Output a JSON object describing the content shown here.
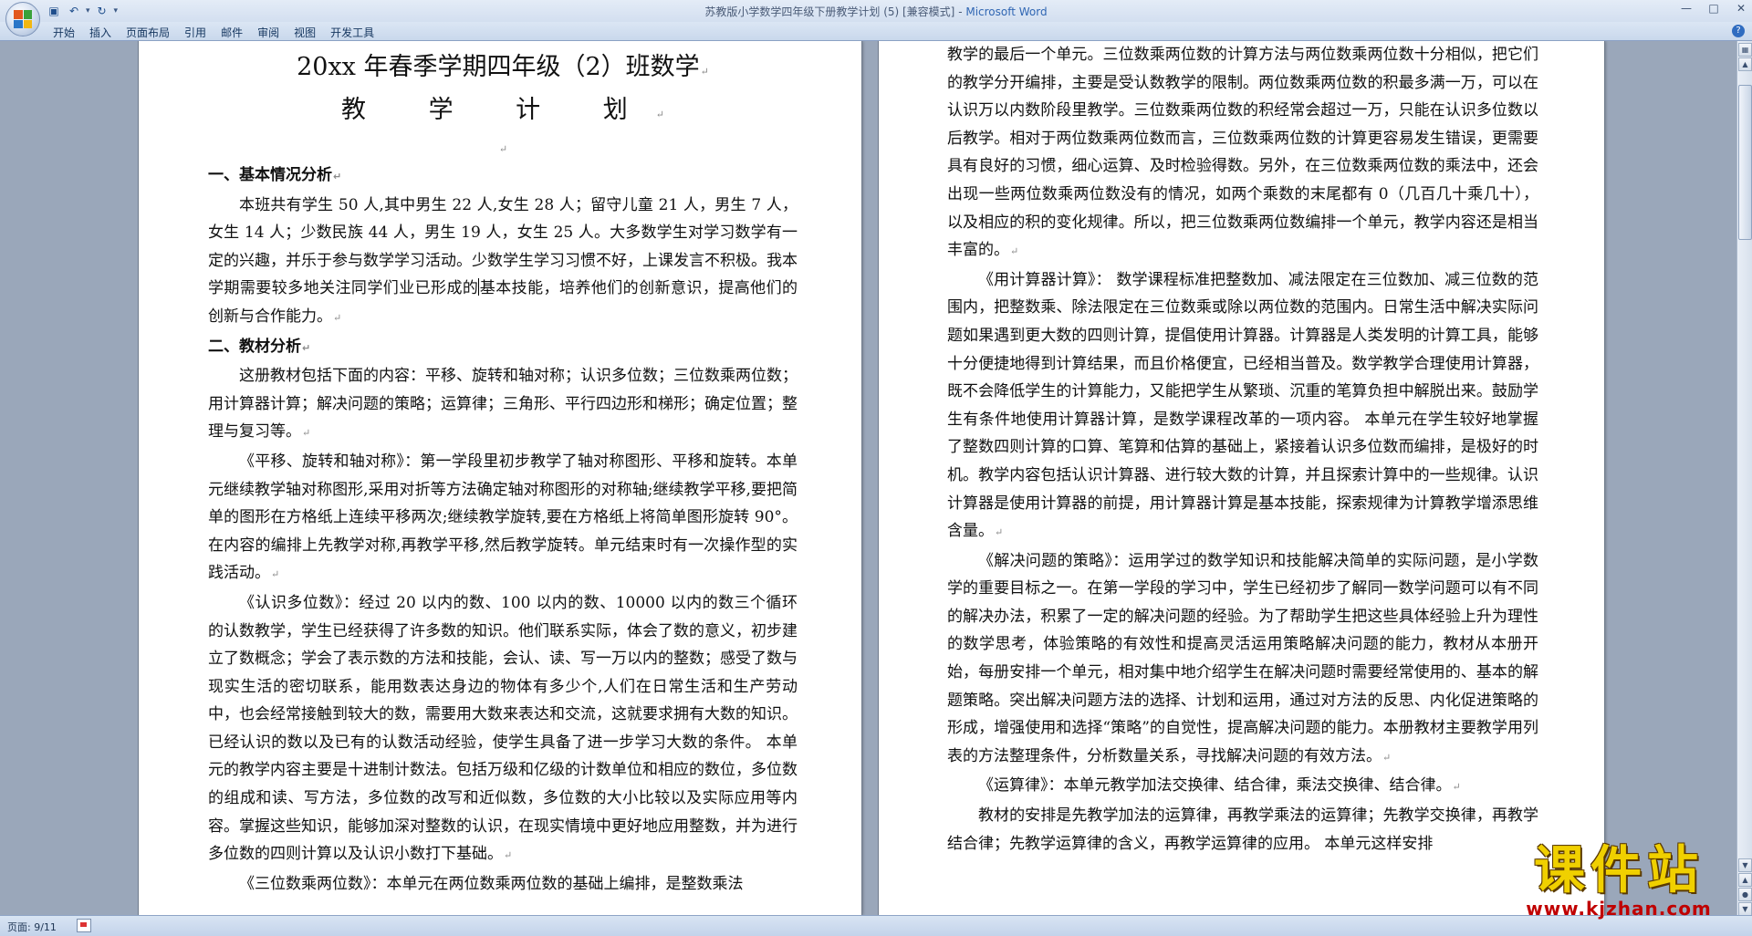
{
  "window": {
    "title": "苏教版小学数学四年级下册教学计划 (5) [兼容模式]",
    "app_name": "Microsoft Word",
    "title_separator": " - "
  },
  "quick_access": {
    "icons": [
      "save-icon",
      "undo-icon",
      "redo-icon",
      "customize-icon"
    ]
  },
  "ribbon": {
    "tabs": [
      "开始",
      "插入",
      "页面布局",
      "引用",
      "邮件",
      "审阅",
      "视图",
      "开发工具"
    ],
    "help_label": "?"
  },
  "status": {
    "page": "页面: 9/11"
  },
  "colors": {
    "app_background": "#9aa7ba",
    "title_blue": "#3066b3",
    "watermark_yellow": "#f0d000",
    "watermark_red": "#c00000"
  },
  "left_page": {
    "title_line1": "20xx 年春季学期四年级（2）班数学",
    "title_line2": "教 学 计 划",
    "section1_heading": "一、基本情况分析",
    "p1_before_cursor": "本班共有学生 50 人,其中男生 22 人,女生 28 人；留守儿童 21 人，男生 7 人，女生 14 人；少数民族 44 人，男生 19 人，女生 25 人。大多数学生对学习数学有一定的兴趣，并乐于参与数学学习活动。少数学生学习习惯不好，上课发言不积极。我本学期需要较多地关注同学们业已形成的",
    "p1_after_cursor": "基本技能，培养他们的创新意识，提高他们的创新与合作能力。",
    "section2_heading": "二、教材分析",
    "p2": "这册教材包括下面的内容：平移、旋转和轴对称；认识多位数；三位数乘两位数；用计算器计算；解决问题的策略；运算律；三角形、平行四边形和梯形；确定位置；整理与复习等。",
    "p3": "《平移、旋转和轴对称》：第一学段里初步教学了轴对称图形、平移和旋转。本单元继续教学轴对称图形,采用对折等方法确定轴对称图形的对称轴;继续教学平移,要把简单的图形在方格纸上连续平移两次;继续教学旋转,要在方格纸上将简单图形旋转 90°。在内容的编排上先教学对称,再教学平移,然后教学旋转。单元结束时有一次操作型的实践活动。",
    "p4": "《认识多位数》：经过 20 以内的数、100 以内的数、10000 以内的数三个循环的认数教学，学生已经获得了许多数的知识。他们联系实际，体会了数的意义，初步建立了数概念；学会了表示数的方法和技能，会认、读、写一万以内的整数；感受了数与现实生活的密切联系，能用数表达身边的物体有多少个,人们在日常生活和生产劳动中，也会经常接触到较大的数，需要用大数来表达和交流，这就要求拥有大数的知识。已经认识的数以及已有的认数活动经验，使学生具备了进一步学习大数的条件。      本单元的教学内容主要是十进制计数法。包括万级和亿级的计数单位和相应的数位，多位数的组成和读、写方法，多位数的改写和近似数，多位数的大小比较以及实际应用等内容。掌握这些知识，能够加深对整数的认识，在现实情境中更好地应用整数，并为进行多位数的四则计算以及认识小数打下基础。",
    "p5": "《三位数乘两位数》：本单元在两位数乘两位数的基础上编排，是整数乘法"
  },
  "right_page": {
    "p1": "教学的最后一个单元。三位数乘两位数的计算方法与两位数乘两位数十分相似，把它们的教学分开编排，主要是受认数教学的限制。两位数乘两位数的积最多满一万，可以在认识万以内数阶段里教学。三位数乘两位数的积经常会超过一万，只能在认识多位数以后教学。相对于两位数乘两位数而言，三位数乘两位数的计算更容易发生错误，更需要具有良好的习惯，细心运算、及时检验得数。另外，在三位数乘两位数的乘法中，还会出现一些两位数乘两位数没有的情况，如两个乘数的末尾都有 0（几百几十乘几十），以及相应的积的变化规律。所以，把三位数乘两位数编排一个单元，教学内容还是相当丰富的。",
    "p2": "《用计算器计算》：     数学课程标准把整数加、减法限定在三位数加、减三位数的范围内，把整数乘、除法限定在三位数乘或除以两位数的范围内。日常生活中解决实际问题如果遇到更大数的四则计算，提倡使用计算器。计算器是人类发明的计算工具，能够十分便捷地得到计算结果，而且价格便宜，已经相当普及。数学教学合理使用计算器，既不会降低学生的计算能力，又能把学生从繁琐、沉重的笔算负担中解脱出来。鼓励学生有条件地使用计算器计算，是数学课程改革的一项内容。     本单元在学生较好地掌握了整数四则计算的口算、笔算和估算的基础上，紧接着认识多位数而编排，是极好的时机。教学内容包括认识计算器、进行较大数的计算，并且探索计算中的一些规律。认识计算器是使用计算器的前提，用计算器计算是基本技能，探索规律为计算教学增添思维含量。",
    "p3": "《解决问题的策略》：运用学过的数学知识和技能解决简单的实际问题，是小学数学的重要目标之一。在第一学段的学习中，学生已经初步了解同一数学问题可以有不同的解决办法，积累了一定的解决问题的经验。为了帮助学生把这些具体经验上升为理性的数学思考，体验策略的有效性和提高灵活运用策略解决问题的能力，教材从本册开始，每册安排一个单元，相对集中地介绍学生在解决问题时需要经常使用的、基本的解题策略。突出解决问题方法的选择、计划和运用，通过对方法的反思、内化促进策略的形成，增强使用和选择“策略”的自觉性，提高解决问题的能力。本册教材主要教学用列表的方法整理条件，分析数量关系，寻找解决问题的有效方法。",
    "p4": "《运算律》：本单元教学加法交换律、结合律，乘法交换律、结合律。",
    "p5": "教材的安排是先教学加法的运算律，再教学乘法的运算律；先教学交换律，再教学结合律；先教学运算律的含义，再教学运算律的应用。  本单元这样安排"
  },
  "watermark": {
    "main": "课件站",
    "url": "www.kjzhan.com"
  }
}
